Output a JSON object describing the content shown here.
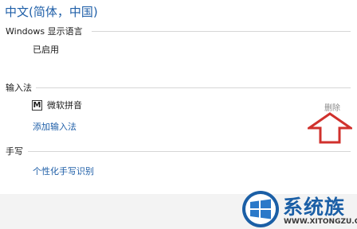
{
  "page": {
    "title": "中文(简体，中国)"
  },
  "display_language": {
    "header": "Windows 显示语言",
    "status": "已启用"
  },
  "input_methods": {
    "header": "输入法",
    "items": [
      {
        "icon": "M",
        "label": "微软拼音",
        "remove_label": "删除"
      }
    ],
    "add_label": "添加输入法"
  },
  "handwriting": {
    "header": "手写",
    "personalize_label": "个性化手写识别"
  },
  "annotation": {
    "arrow_icon": "up-arrow-icon",
    "color": "#d0312d"
  },
  "watermark": {
    "name": "系统族",
    "url": "WWW.XITONGZU.COM",
    "logo_icon": "windows-logo-icon"
  },
  "colors": {
    "link": "#1f5fa8",
    "muted": "#8a8a8a",
    "brand": "#1b5fa6"
  }
}
